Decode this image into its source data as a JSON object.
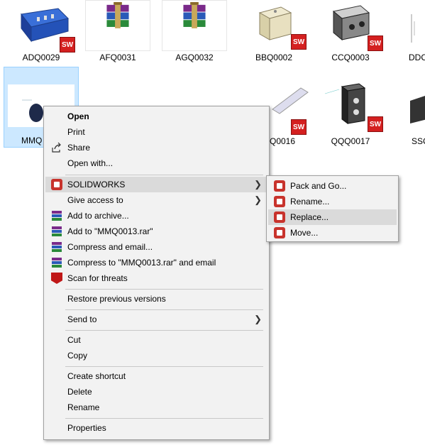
{
  "files": [
    {
      "name": "ADQ0029",
      "badge": "SW"
    },
    {
      "name": "AFQ0031"
    },
    {
      "name": "AGQ0032"
    },
    {
      "name": "BBQ0002",
      "badge": "SW"
    },
    {
      "name": "CCQ0003",
      "badge": "SW"
    },
    {
      "name": "DDC"
    },
    {
      "name": "MMQ"
    },
    {
      "name": "Q0016",
      "badge": "SW"
    },
    {
      "name": "QQQ0017",
      "badge": "SW"
    },
    {
      "name": "SSC"
    }
  ],
  "context_menu": {
    "open": "Open",
    "print": "Print",
    "share": "Share",
    "open_with": "Open with...",
    "solidworks": "SOLIDWORKS",
    "give_access": "Give access to",
    "add_archive": "Add to archive...",
    "add_rar": "Add to \"MMQ0013.rar\"",
    "compress_email": "Compress and email...",
    "compress_rar_email": "Compress to \"MMQ0013.rar\" and email",
    "scan": "Scan for threats",
    "restore": "Restore previous versions",
    "send_to": "Send to",
    "cut": "Cut",
    "copy": "Copy",
    "create_shortcut": "Create shortcut",
    "delete": "Delete",
    "rename": "Rename",
    "properties": "Properties"
  },
  "submenu": {
    "pack_go": "Pack and Go...",
    "rename": "Rename...",
    "replace": "Replace...",
    "move": "Move..."
  },
  "icons": {
    "share": "share-icon",
    "solidworks": "solidworks-icon",
    "winrar": "winrar-icon",
    "mcafee": "mcafee-icon",
    "arrow": "chevron-right-icon"
  },
  "colors": {
    "selection": "#cce8ff",
    "menu_bg": "#f2f2f2",
    "highlight": "#dadada",
    "sw_red": "#d42020"
  }
}
